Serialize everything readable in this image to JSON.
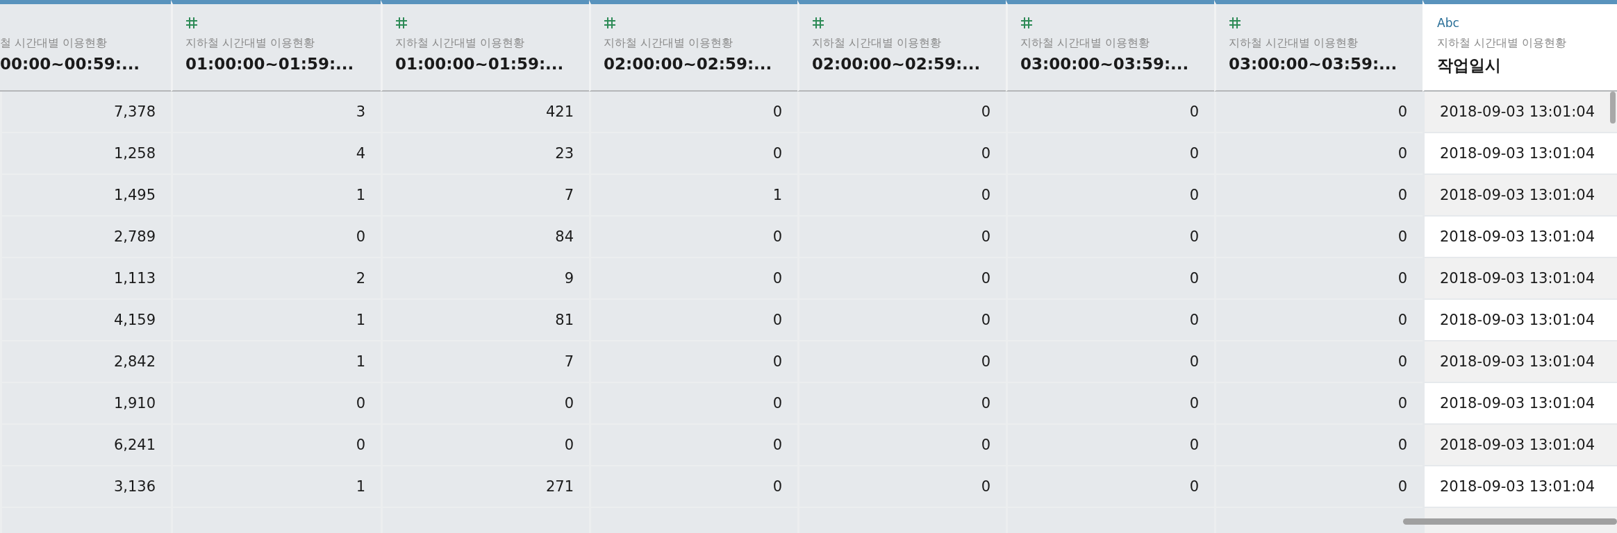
{
  "table": {
    "columns": [
      {
        "source": "철 시간대별 이용현황",
        "title": "00:00~00:59:...",
        "dimmed": true
      },
      {
        "kind": "number",
        "source": "지하철 시간대별 이용현황",
        "title": "01:00:00~01:59:...",
        "dimmed": true
      },
      {
        "kind": "number",
        "source": "지하철 시간대별 이용현황",
        "title": "01:00:00~01:59:...",
        "dimmed": true
      },
      {
        "kind": "number",
        "source": "지하철 시간대별 이용현황",
        "title": "02:00:00~02:59:...",
        "dimmed": true
      },
      {
        "kind": "number",
        "source": "지하철 시간대별 이용현황",
        "title": "02:00:00~02:59:...",
        "dimmed": true
      },
      {
        "kind": "number",
        "source": "지하철 시간대별 이용현황",
        "title": "03:00:00~03:59:...",
        "dimmed": true
      },
      {
        "kind": "number",
        "source": "지하철 시간대별 이용현황",
        "title": "03:00:00~03:59:...",
        "dimmed": true
      },
      {
        "kind": "string",
        "type_label": "Abc",
        "source": "지하철 시간대별 이용현황",
        "title": "작업일시",
        "dimmed": false
      }
    ],
    "rows": [
      [
        "7,378",
        "3",
        "421",
        "0",
        "0",
        "0",
        "0",
        "2018-09-03 13:01:04"
      ],
      [
        "1,258",
        "4",
        "23",
        "0",
        "0",
        "0",
        "0",
        "2018-09-03 13:01:04"
      ],
      [
        "1,495",
        "1",
        "7",
        "1",
        "0",
        "0",
        "0",
        "2018-09-03 13:01:04"
      ],
      [
        "2,789",
        "0",
        "84",
        "0",
        "0",
        "0",
        "0",
        "2018-09-03 13:01:04"
      ],
      [
        "1,113",
        "2",
        "9",
        "0",
        "0",
        "0",
        "0",
        "2018-09-03 13:01:04"
      ],
      [
        "4,159",
        "1",
        "81",
        "0",
        "0",
        "0",
        "0",
        "2018-09-03 13:01:04"
      ],
      [
        "2,842",
        "1",
        "7",
        "0",
        "0",
        "0",
        "0",
        "2018-09-03 13:01:04"
      ],
      [
        "1,910",
        "0",
        "0",
        "0",
        "0",
        "0",
        "0",
        "2018-09-03 13:01:04"
      ],
      [
        "6,241",
        "0",
        "0",
        "0",
        "0",
        "0",
        "0",
        "2018-09-03 13:01:04"
      ],
      [
        "3,136",
        "1",
        "271",
        "0",
        "0",
        "0",
        "0",
        "2018-09-03 13:01:04"
      ]
    ]
  }
}
